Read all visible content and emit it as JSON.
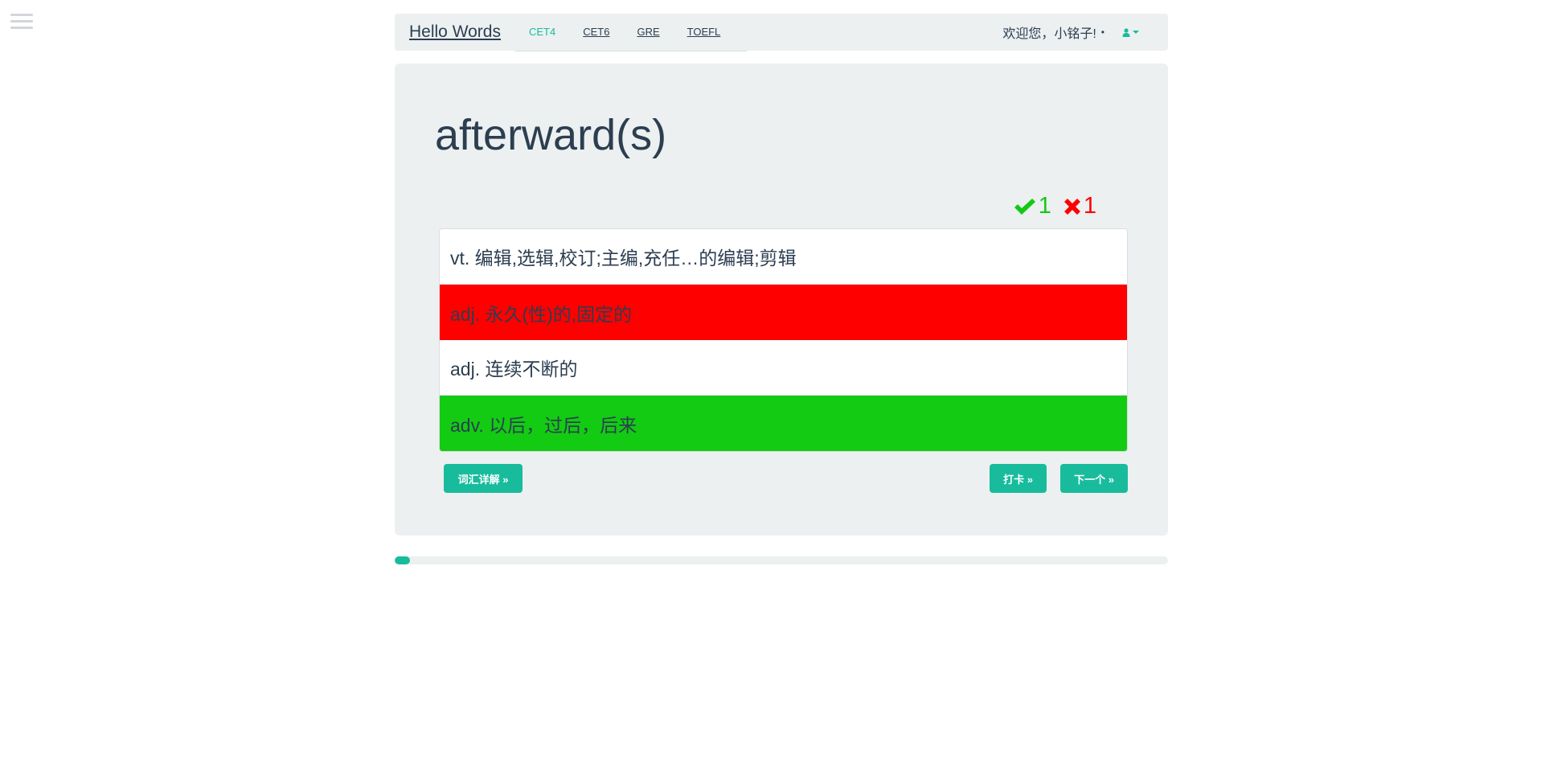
{
  "navbar": {
    "brand": "Hello Words",
    "links": [
      "CET4",
      "CET6",
      "GRE",
      "TOEFL"
    ],
    "active_link": "CET4",
    "welcome": "欢迎您，小铭子!",
    "dot": "•",
    "user_icon": "user-icon"
  },
  "word": {
    "text": "afterward(s)"
  },
  "stats": {
    "correct_count": "1",
    "wrong_count": "1",
    "correct_icon": "check-icon",
    "wrong_icon": "cross-icon"
  },
  "options": [
    {
      "text": "vt. 编辑,选辑,校订;主编,充任…的编辑;剪辑",
      "state": "neutral"
    },
    {
      "text": "adj. 永久(性)的,固定的",
      "state": "wrong"
    },
    {
      "text": "adj. 连续不断的",
      "state": "neutral"
    },
    {
      "text": "adv. 以后，过后，后来",
      "state": "correct"
    }
  ],
  "buttons": {
    "detail": "词汇详解 »",
    "checkin": "打卡 »",
    "next": "下一个 »"
  },
  "progress": {
    "fraction": 0.02
  },
  "colors": {
    "accent": "#18bc9c",
    "correct": "#13cb13",
    "wrong": "#ff0000",
    "text": "#2c3e50",
    "panel": "#ecf0f1"
  }
}
